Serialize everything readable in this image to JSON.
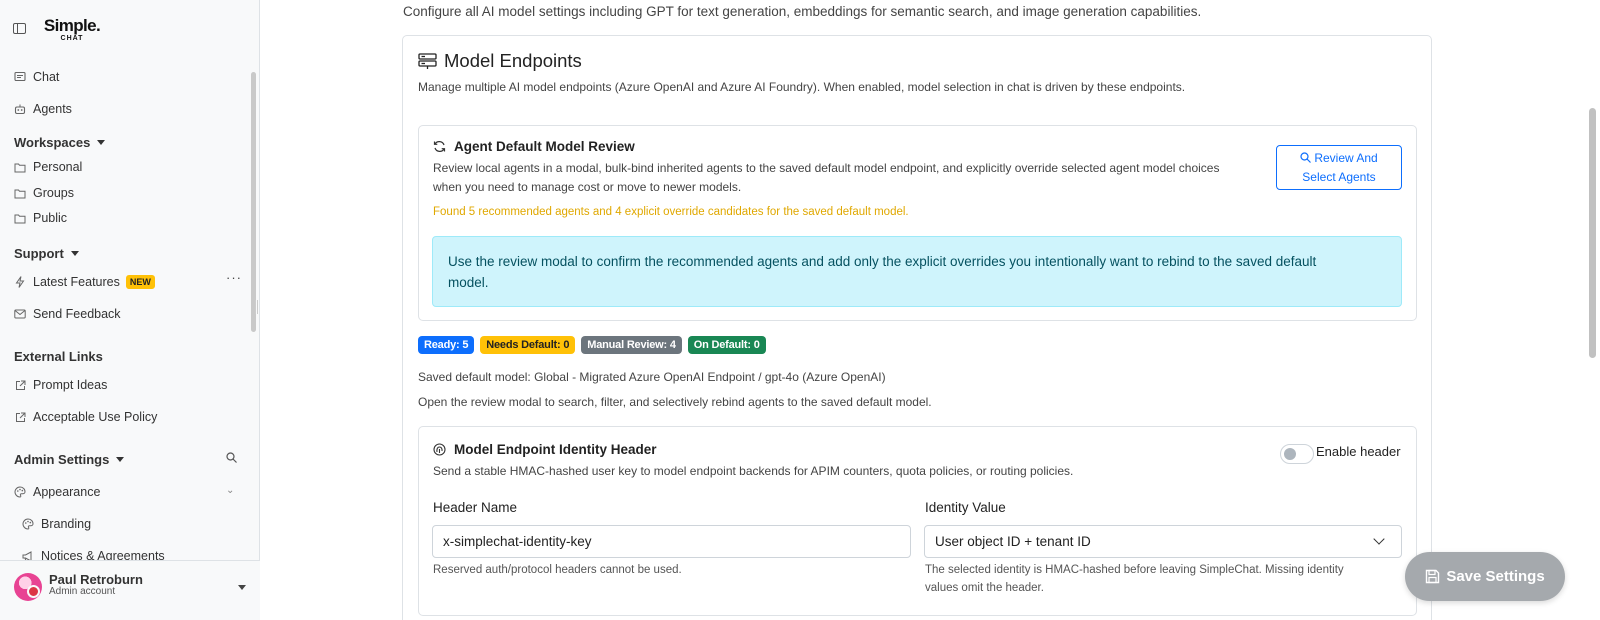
{
  "sidebar": {
    "logo_main": "Simple.",
    "logo_sub": "CHAT",
    "chat": "Chat",
    "agents": "Agents",
    "workspaces_head": "Workspaces",
    "personal": "Personal",
    "groups": "Groups",
    "public": "Public",
    "support_head": "Support",
    "latest_features": "Latest Features",
    "new_badge": "NEW",
    "more": "···",
    "send_feedback": "Send Feedback",
    "external_links_head": "External Links",
    "prompt_ideas": "Prompt Ideas",
    "acceptable_use": "Acceptable Use Policy",
    "admin_settings_head": "Admin Settings",
    "appearance": "Appearance",
    "branding": "Branding",
    "notices": "Notices & Agreements"
  },
  "user": {
    "name": "Paul Retroburn",
    "role": "Admin account"
  },
  "main": {
    "intro": "Configure all AI model settings including GPT for text generation, embeddings for semantic search, and image generation capabilities.",
    "endpoints_title": "Model Endpoints",
    "endpoints_desc": "Manage multiple AI model endpoints (Azure OpenAI and Azure AI Foundry). When enabled, model selection in chat is driven by these endpoints.",
    "review_card": {
      "title": "Agent Default Model Review",
      "desc_line1": "Review local agents in a modal, bulk-bind inherited agents to the saved default model endpoint, and explicitly override selected agent model choices",
      "desc_line2": "when you need to manage cost or move to newer models.",
      "warning": "Found 5 recommended agents and 4 explicit override candidates for the saved default model.",
      "info_line1": "Use the review modal to confirm the recommended agents and add only the explicit overrides you intentionally want to rebind to the saved default",
      "info_line2": "model.",
      "button_line1": "Review And",
      "button_line2": "Select Agents"
    },
    "badges": {
      "ready": "Ready: 5",
      "needs_default": "Needs Default: 0",
      "manual_review": "Manual Review: 4",
      "on_default": "On Default: 0"
    },
    "saved_default": "Saved default model: Global - Migrated Azure OpenAI Endpoint / gpt-4o (Azure OpenAI)",
    "open_review": "Open the review modal to search, filter, and selectively rebind agents to the saved default model.",
    "identity_card": {
      "title": "Model Endpoint Identity Header",
      "desc": "Send a stable HMAC-hashed user key to model endpoint backends for APIM counters, quota policies, or routing policies.",
      "toggle_label": "Enable header",
      "header_name_label": "Header Name",
      "header_name_value": "x-simplechat-identity-key",
      "header_name_help": "Reserved auth/protocol headers cannot be used.",
      "identity_label": "Identity Value",
      "identity_value": "User object ID + tenant ID",
      "identity_help_line1": "The selected identity is HMAC-hashed before leaving SimpleChat. Missing identity",
      "identity_help_line2": "values omit the header."
    },
    "save_button": "Save Settings"
  }
}
